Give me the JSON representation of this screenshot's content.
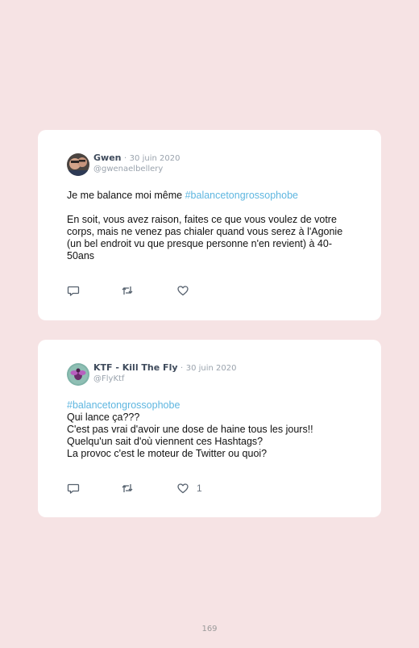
{
  "tweets": [
    {
      "author_name": "Gwen",
      "separator": "·",
      "date": "30 juin 2020",
      "handle": "@gwenaelbellery",
      "body_line1_prefix": "Je me balance moi même ",
      "body_line1_hashtag": "#balancetongrossophobe",
      "body_paragraph2": "En soit, vous avez raison, faites ce que vous voulez de votre corps, mais ne venez pas chialer quand vous serez à l'Agonie (un bel endroit vu que presque personne n'en revient) à 40-50ans",
      "reply_icon": "reply-icon",
      "retweet_icon": "retweet-icon",
      "like_icon": "heart-icon"
    },
    {
      "author_name": "KTF - Kill The Fly",
      "separator": "·",
      "date": "30 juin 2020",
      "handle": "@FlyKtf",
      "hashtag_line": "#balancetongrossophobe",
      "lines": [
        "Qui lance ça???",
        "C'est pas vrai d'avoir une dose de haine tous les jours!!",
        "Quelqu'un sait d'où viennent ces Hashtags?",
        "La provoc c'est le moteur de Twitter ou quoi?"
      ],
      "like_count": "1",
      "reply_icon": "reply-icon",
      "retweet_icon": "retweet-icon",
      "like_icon": "heart-icon"
    }
  ],
  "page_number": "169",
  "colors": {
    "page_background": "#f6e3e4",
    "card_background": "#ffffff",
    "hashtag": "#5eb6e0",
    "author_name": "#3f4b5c",
    "muted": "#9aa3ad"
  }
}
